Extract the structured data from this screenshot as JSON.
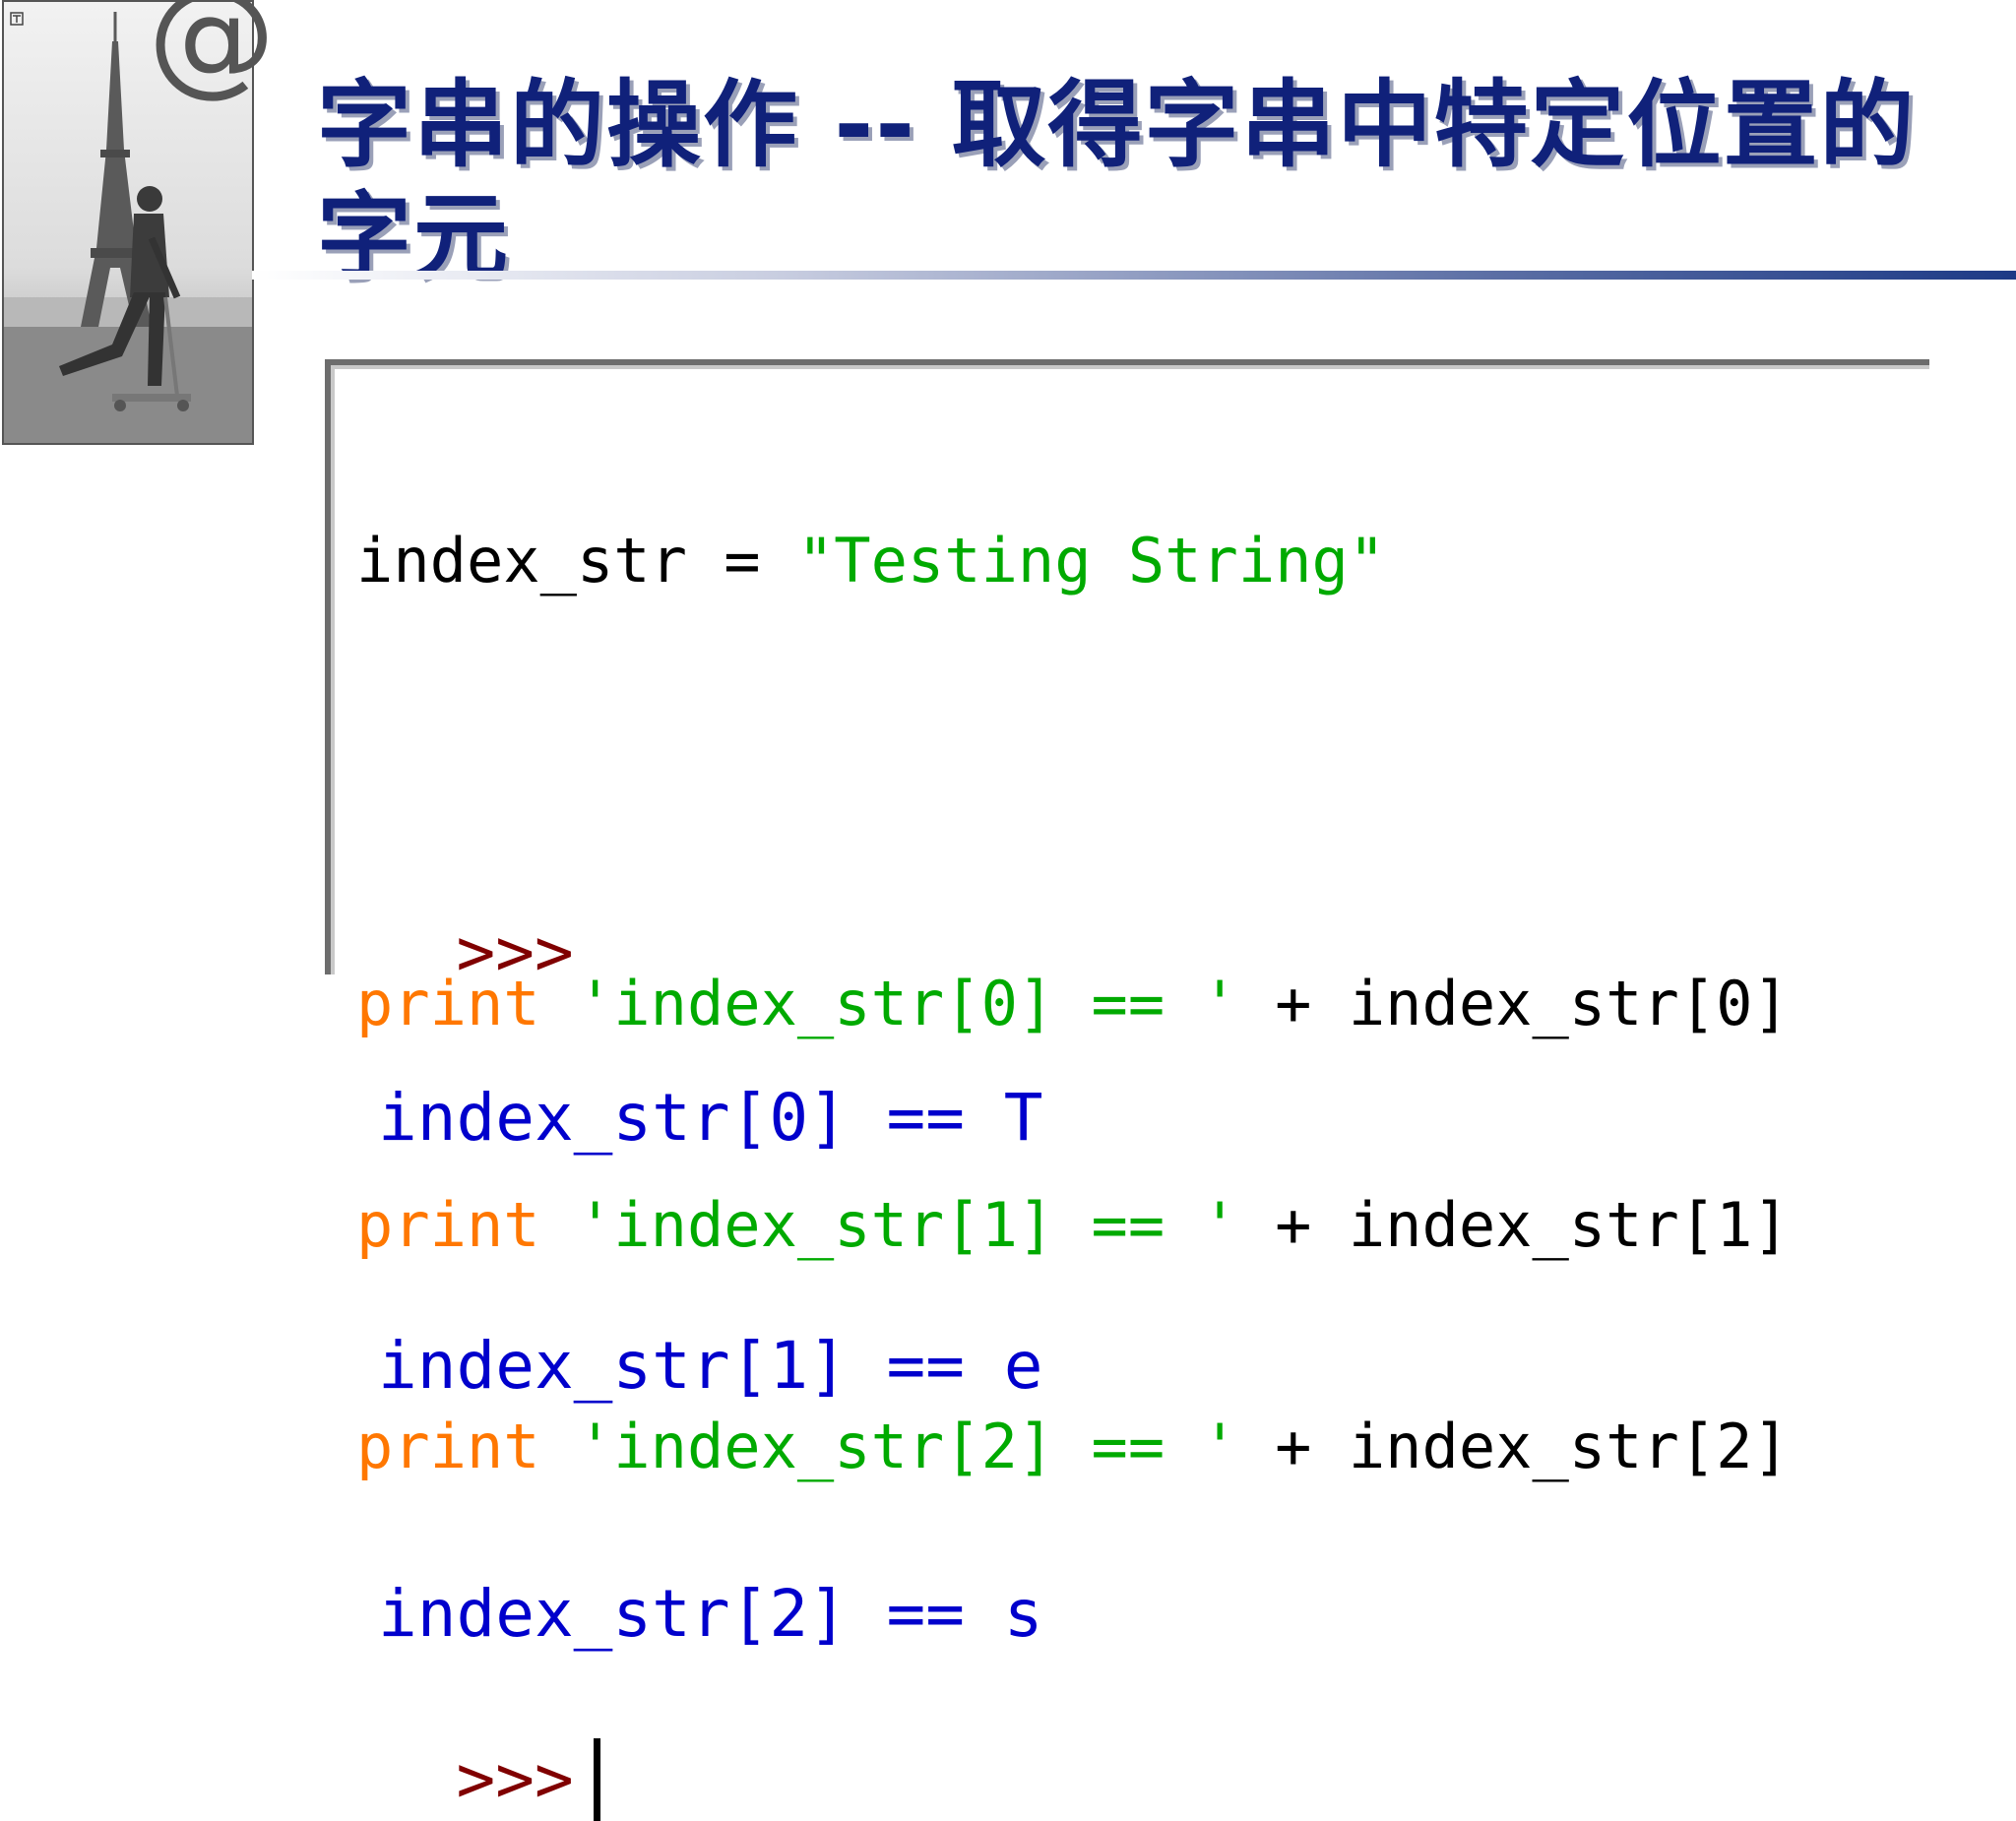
{
  "title": "字串的操作 -- 取得字串中特定位置的字元",
  "icons": {
    "logo": "at-symbol-icon",
    "photo": "eiffel-tower-scooter-photo"
  },
  "logo_text": "@",
  "code": {
    "assign": {
      "var": "index_str",
      "op": " = ",
      "value": "\"Testing String\""
    },
    "print_lines": [
      {
        "kw": "print",
        "str": "'index_str[0] == '",
        "rest": " + index_str[0]"
      },
      {
        "kw": "print",
        "str": "'index_str[1] == '",
        "rest": " + index_str[1]"
      },
      {
        "kw": "print",
        "str": "'index_str[2] == '",
        "rest": " + index_str[2]"
      }
    ]
  },
  "output": {
    "prompt": ">>>",
    "lines": [
      "index_str[0] == T",
      "index_str[1] == e",
      "index_str[2] == s"
    ],
    "final_prompt": ">>>"
  },
  "colors": {
    "title": "#10217a",
    "keyword": "#ff7700",
    "string": "#00aa00",
    "prompt": "#800000",
    "result": "#0000cc"
  }
}
